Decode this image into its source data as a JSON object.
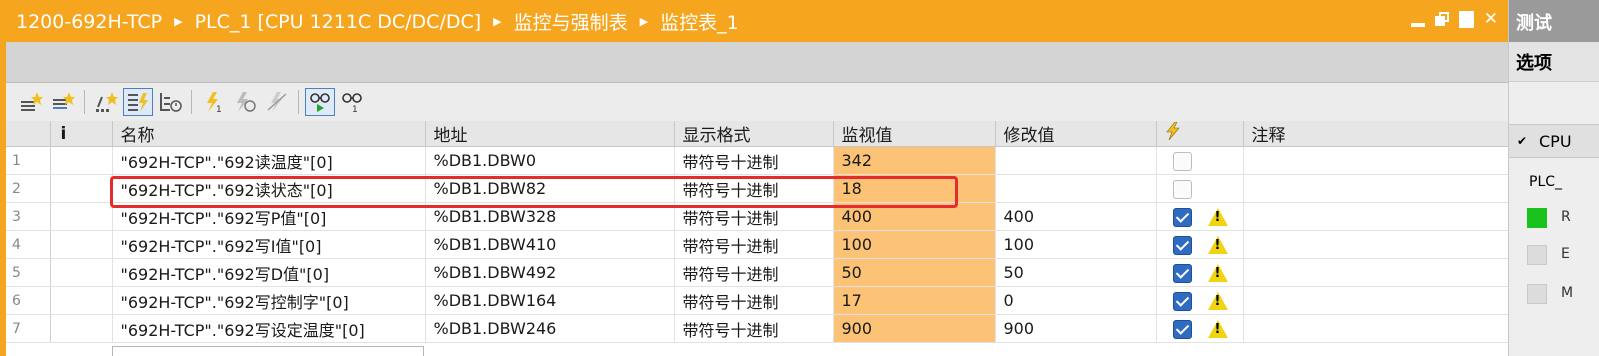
{
  "window": {
    "breadcrumb": [
      "1200-692H-TCP",
      "PLC_1 [CPU 1211C DC/DC/DC]",
      "监控与强制表",
      "监控表_1"
    ]
  },
  "table": {
    "columns": [
      "i",
      "名称",
      "地址",
      "显示格式",
      "监视值",
      "修改值",
      "注释"
    ],
    "rows": [
      {
        "num": "1",
        "name": "\"692H-TCP\".\"692读温度\"[0]",
        "address": "%DB1.DBW0",
        "format": "带符号十进制",
        "monitor": "342",
        "modify": "",
        "checked": false,
        "warning": false
      },
      {
        "num": "2",
        "name": "\"692H-TCP\".\"692读状态\"[0]",
        "address": "%DB1.DBW82",
        "format": "带符号十进制",
        "monitor": "18",
        "modify": "",
        "checked": false,
        "warning": false
      },
      {
        "num": "3",
        "name": "\"692H-TCP\".\"692写P值\"[0]",
        "address": "%DB1.DBW328",
        "format": "带符号十进制",
        "monitor": "400",
        "modify": "400",
        "checked": true,
        "warning": true
      },
      {
        "num": "4",
        "name": "\"692H-TCP\".\"692写I值\"[0]",
        "address": "%DB1.DBW410",
        "format": "带符号十进制",
        "monitor": "100",
        "modify": "100",
        "checked": true,
        "warning": true
      },
      {
        "num": "5",
        "name": "\"692H-TCP\".\"692写D值\"[0]",
        "address": "%DB1.DBW492",
        "format": "带符号十进制",
        "monitor": "50",
        "modify": "50",
        "checked": true,
        "warning": true
      },
      {
        "num": "6",
        "name": "\"692H-TCP\".\"692写控制字\"[0]",
        "address": "%DB1.DBW164",
        "format": "带符号十进制",
        "monitor": "17",
        "modify": "0",
        "checked": true,
        "warning": true
      },
      {
        "num": "7",
        "name": "\"692H-TCP\".\"692写设定温度\"[0]",
        "address": "%DB1.DBW246",
        "format": "带符号十进制",
        "monitor": "900",
        "modify": "900",
        "checked": true,
        "warning": true
      }
    ]
  },
  "side_panel": {
    "title": "测试",
    "options": "选项",
    "section": "CPU",
    "plc_label": "PLC_",
    "led_labels": [
      "R",
      "E",
      "M"
    ]
  },
  "colors": {
    "title_bar": "#f6a51e",
    "monitor_column": "#fcc275",
    "highlight_box": "#e52b2b",
    "run_led": "#19c21d"
  },
  "toolbar_icons": [
    "insert-row-icon",
    "add-row-icon",
    "insert-comment-row-icon",
    "show-modify-values-icon",
    "show-extended-mode-icon",
    "modify-now-icon",
    "modify-trigger-icon",
    "enable-peripheral-outputs-icon",
    "monitor-all-icon",
    "monitor-once-icon"
  ]
}
